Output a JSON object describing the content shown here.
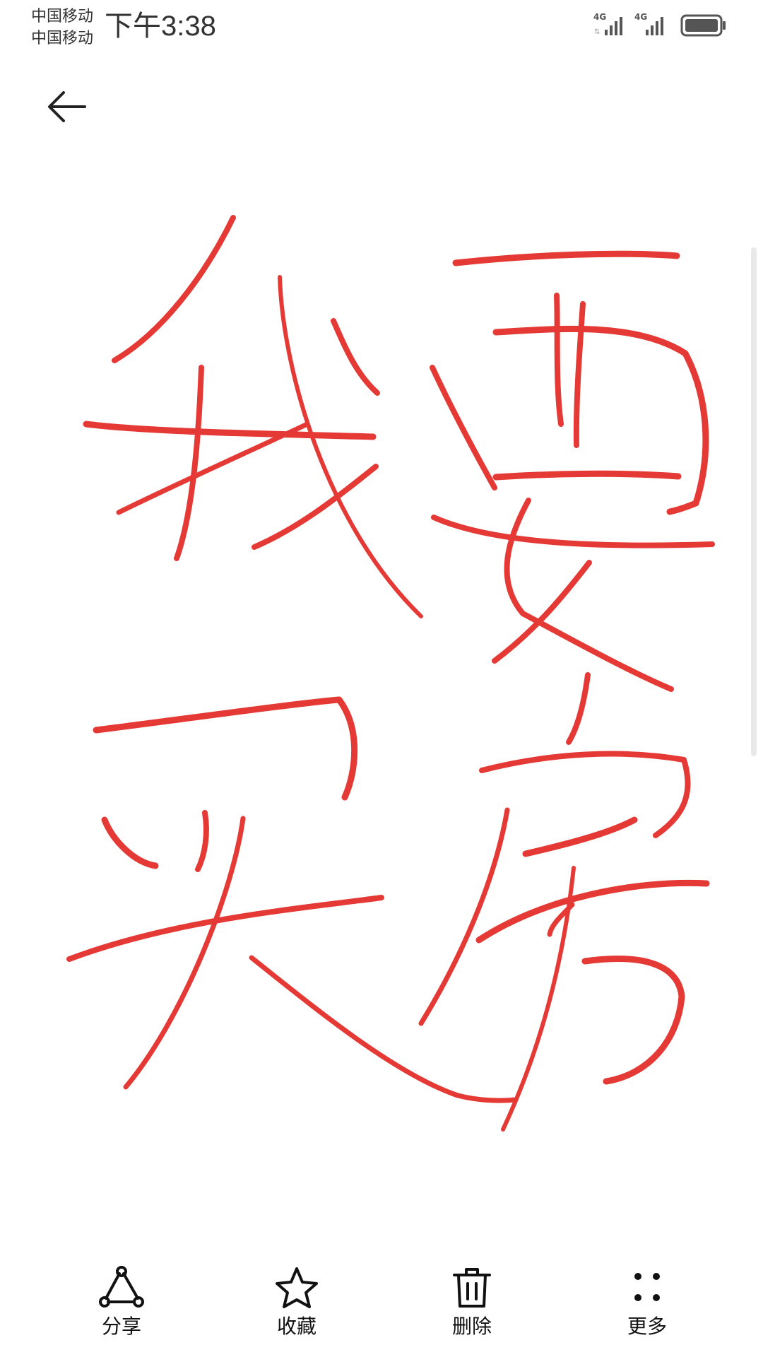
{
  "status_bar": {
    "carrier_1": "中国移动",
    "carrier_2": "中国移动",
    "time": "下午3:38",
    "network_1": "4G",
    "network_2": "4G"
  },
  "note": {
    "ink_color": "#e53935",
    "handwritten_lines": [
      "我要",
      "买房"
    ]
  },
  "toolbar": {
    "share_label": "分享",
    "favorite_label": "收藏",
    "delete_label": "删除",
    "more_label": "更多"
  }
}
